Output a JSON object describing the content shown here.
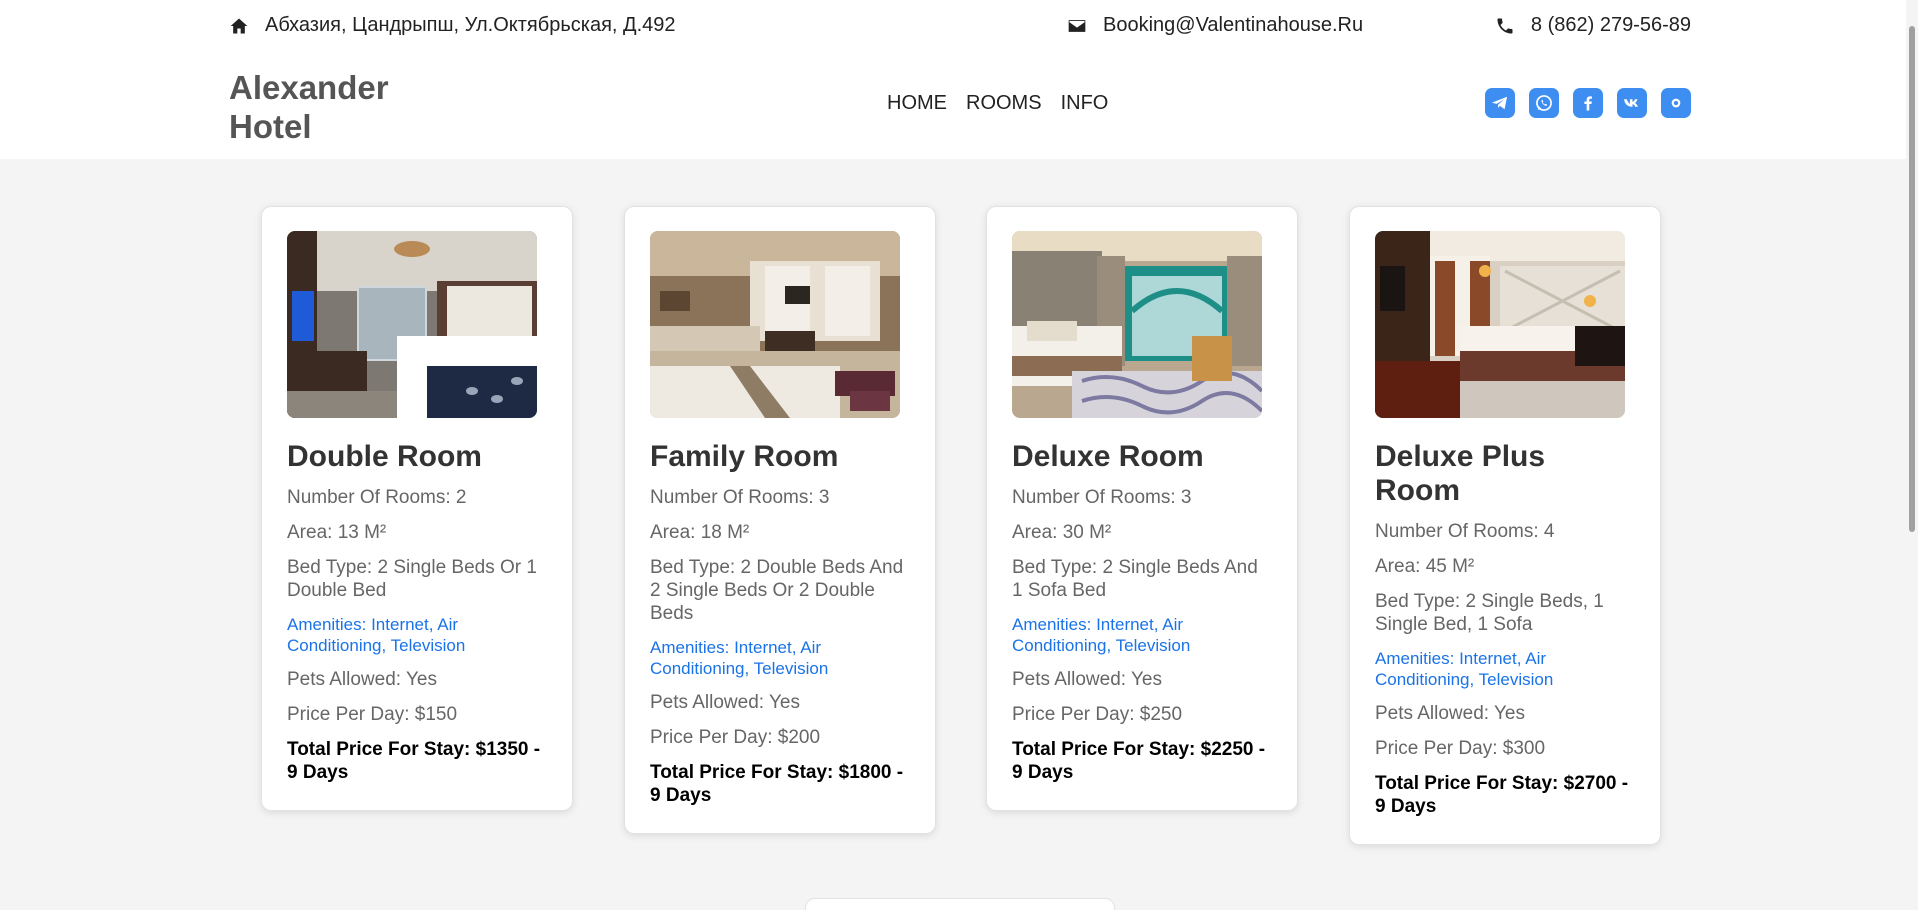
{
  "header": {
    "address": "Абхазия, Цандрыпш, Ул.Октябрьская, Д.492",
    "email": "Booking@Valentinahouse.Ru",
    "phone": "8 (862) 279-56-89",
    "logo_line1": "Alexander",
    "logo_line2": "Hotel",
    "icons": {
      "address": "home-icon",
      "email": "envelope-icon",
      "phone": "phone-icon"
    }
  },
  "nav": {
    "items": [
      "HOME",
      "ROOMS",
      "INFO"
    ]
  },
  "socials": [
    "telegram-icon",
    "whatsapp-icon",
    "facebook-icon",
    "vk-icon",
    "instagram-icon"
  ],
  "colors": {
    "accent": "#3d8ef0",
    "link": "#1a73e8",
    "background": "#f4f4f4"
  },
  "rooms": [
    {
      "title": "Double Room",
      "rooms": "Number Of Rooms: 2",
      "area": "Area: 13 M²",
      "bed": "Bed Type: 2 Single Beds Or 1 Double Bed",
      "amenities": "Amenities: Internet, Air Conditioning, Television",
      "pets": "Pets Allowed: Yes",
      "price": "Price Per Day: $150",
      "total": "Total Price For Stay: $1350 - 9 Days"
    },
    {
      "title": "Family Room",
      "rooms": "Number Of Rooms: 3",
      "area": "Area: 18 M²",
      "bed": "Bed Type: 2 Double Beds And 2 Single Beds Or 2 Double Beds",
      "amenities": "Amenities: Internet, Air Conditioning, Television",
      "pets": "Pets Allowed: Yes",
      "price": "Price Per Day: $200",
      "total": "Total Price For Stay: $1800 - 9 Days"
    },
    {
      "title": "Deluxe Room",
      "rooms": "Number Of Rooms: 3",
      "area": "Area: 30 M²",
      "bed": "Bed Type: 2 Single Beds And 1 Sofa Bed",
      "amenities": "Amenities: Internet, Air Conditioning, Television",
      "pets": "Pets Allowed: Yes",
      "price": "Price Per Day: $250",
      "total": "Total Price For Stay: $2250 - 9 Days"
    },
    {
      "title": "Deluxe Plus Room",
      "rooms": "Number Of Rooms: 4",
      "area": "Area: 45 M²",
      "bed": "Bed Type: 2 Single Beds, 1 Single Bed, 1 Sofa",
      "amenities": "Amenities: Internet, Air Conditioning, Television",
      "pets": "Pets Allowed: Yes",
      "price": "Price Per Day: $300",
      "total": "Total Price For Stay: $2700 - 9 Days"
    }
  ]
}
